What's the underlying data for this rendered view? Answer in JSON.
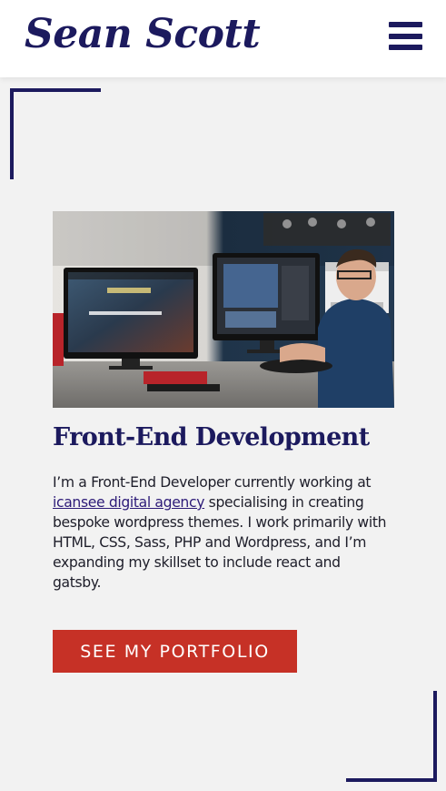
{
  "header": {
    "logo_text": "Sean Scott",
    "menu_icon": "hamburger-menu-icon"
  },
  "hero": {
    "image_alt": "Developer working at a desk with two monitors showing website designs",
    "heading": "Front-End Development",
    "paragraph_before_link": "I’m a Front-End Developer currently working at ",
    "link_text": "icansee digital agency",
    "paragraph_after_link": " specialising in creating bespoke wordpress themes. I work primarily with HTML, CSS, Sass, PHP and Wordpress, and I’m expanding my skillset to include react and gatsby.",
    "cta_label": "SEE MY PORTFOLIO"
  },
  "colors": {
    "brand_navy": "#1c1a5e",
    "cta_red": "#c63126",
    "page_background": "#f2f2f2",
    "header_background": "#ffffff"
  }
}
